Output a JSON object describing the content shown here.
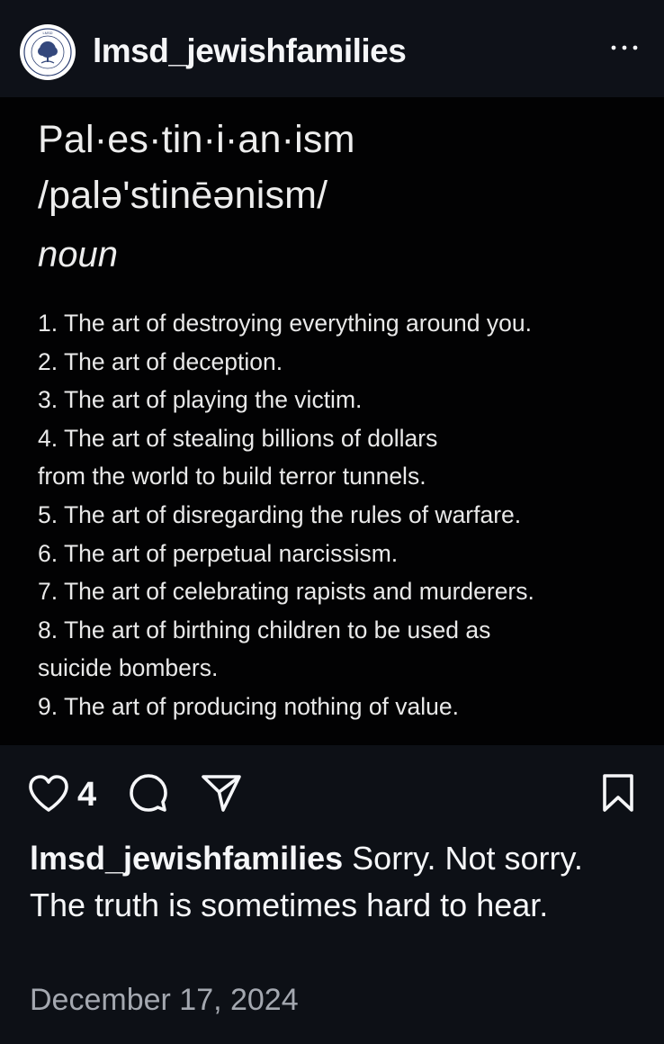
{
  "post": {
    "username": "lmsd_jewishfamilies",
    "more_label": "More options",
    "avatar_text": "LMSD JEWISH FAMILIES ASSOCIATION"
  },
  "image": {
    "word": "Pal·es·tin·i·an·ism",
    "pronunciation": "/palə'stinēənism/",
    "part_of_speech": "noun",
    "definition_lines": [
      "1. The art of destroying everything around you.",
      "2. The art of deception.",
      "3. The art of playing the victim.",
      "4. The art of stealing billions of dollars",
      "from the world to build terror tunnels.",
      "5. The art of disregarding the rules of warfare.",
      "6. The art of perpetual narcissism.",
      "7. The art of celebrating rapists and murderers.",
      "8. The art of birthing children to be used as",
      "suicide bombers.",
      "9. The art of producing nothing of value."
    ]
  },
  "actions": {
    "like_count": "4",
    "icons": [
      "heart-icon",
      "comment-icon",
      "share-icon",
      "bookmark-icon"
    ]
  },
  "caption": {
    "username": "lmsd_jewishfamilies",
    "text": "Sorry. Not sorry. The truth is sometimes hard to hear."
  },
  "date": "December 17, 2024",
  "colors": {
    "background": "#0d1016",
    "image_background": "#020203",
    "text": "#f5f6f8",
    "muted": "#a4a8b0"
  }
}
